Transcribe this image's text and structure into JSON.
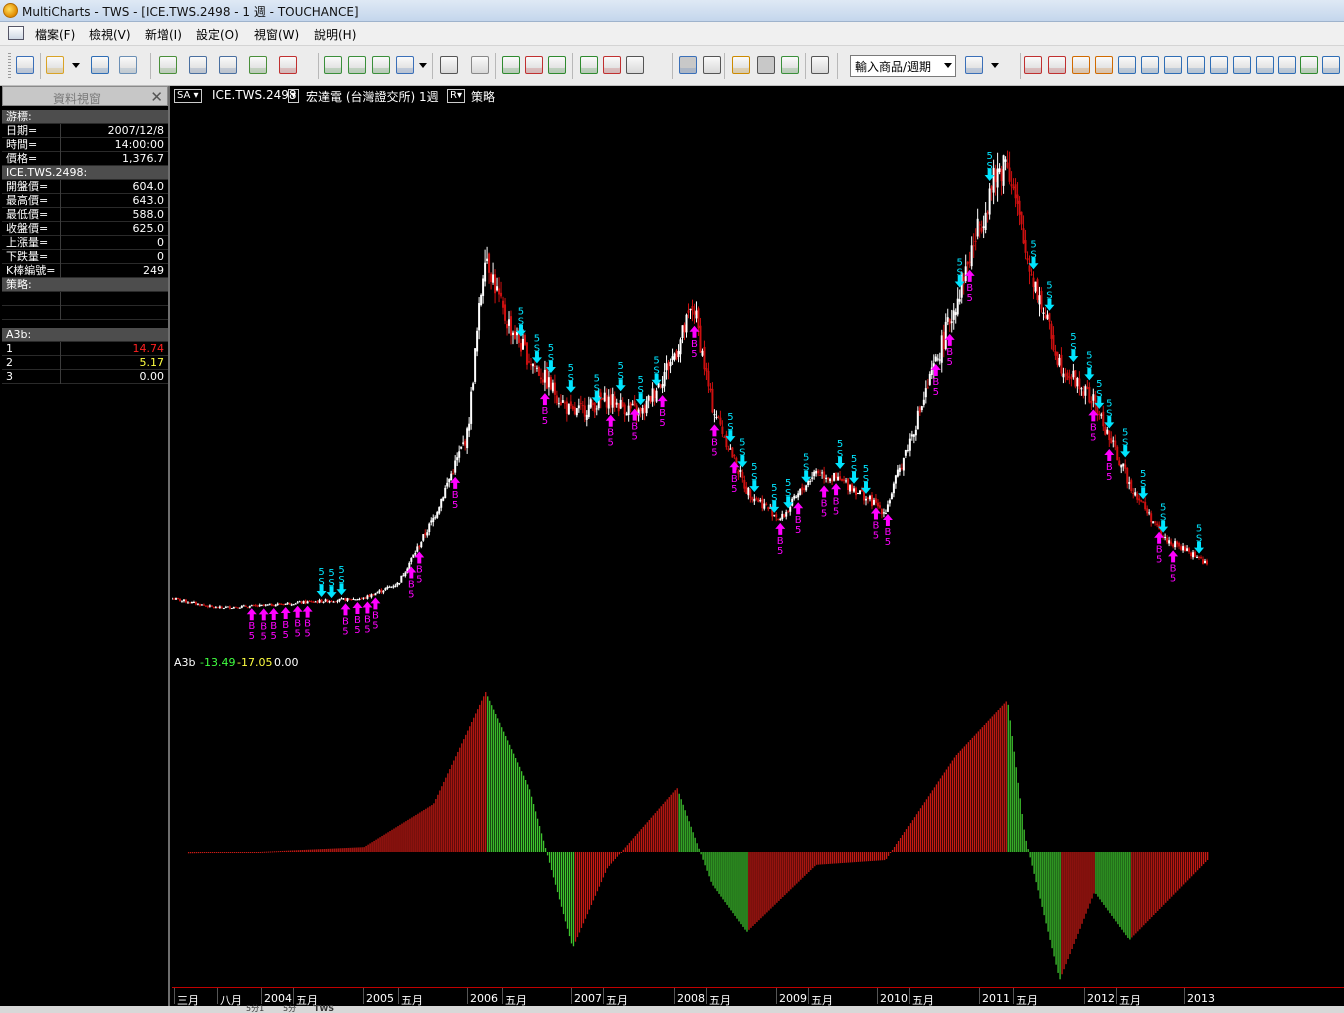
{
  "window": {
    "title": "MultiCharts - TWS - [ICE.TWS.2498 - 1 週 - TOUCHANCE]"
  },
  "menu": [
    "檔案(F)",
    "檢視(V)",
    "新增(I)",
    "設定(O)",
    "視窗(W)",
    "說明(H)"
  ],
  "toolbar": {
    "symbol_combo": "輸入商品/週期",
    "icons": [
      "new-chart-icon",
      "open-icon",
      "save-icon",
      "print-icon",
      "window-icon",
      "window-icon",
      "window-icon",
      "window-icon",
      "window-icon",
      "chart-type-icon",
      "chart-type-icon",
      "chart-type-icon",
      "chart-type-icon",
      "table-icon",
      "table-icon",
      "bars-icon",
      "candles-icon",
      "check-icon",
      "drawing-icon",
      "drawing-icon",
      "drawing-icon",
      "pointer-icon",
      "crosshair-icon",
      "comment-icon",
      "zoom-box-icon",
      "zoom-icon",
      "panel-icon",
      "clock-icon",
      "scroll-left-icon",
      "scroll-right-icon",
      "hourglass-icon",
      "up-down-icon",
      "up-icon",
      "down-icon",
      "left-icon",
      "right-icon",
      "expand-icon",
      "shrink-icon",
      "zoom-in-icon",
      "zoom-out-icon",
      "refresh-icon",
      "autoscale-icon"
    ]
  },
  "data_window": {
    "title": "資料視窗",
    "sections": [
      {
        "heading": "游標:",
        "rows": [
          {
            "label": "日期=",
            "value": "2007/12/8"
          },
          {
            "label": "時間=",
            "value": "14:00:00"
          },
          {
            "label": "價格=",
            "value": "1,376.7"
          }
        ]
      },
      {
        "heading": "ICE.TWS.2498:",
        "rows": [
          {
            "label": "開盤價=",
            "value": "604.0"
          },
          {
            "label": "最高價=",
            "value": "643.0"
          },
          {
            "label": "最低價=",
            "value": "588.0"
          },
          {
            "label": "收盤價=",
            "value": "625.0"
          },
          {
            "label": "上漲量=",
            "value": "0"
          },
          {
            "label": "下跌量=",
            "value": "0"
          },
          {
            "label": "K棒編號=",
            "value": "249"
          }
        ]
      },
      {
        "heading": "策略:",
        "rows": [
          {
            "label": "",
            "value": ""
          },
          {
            "label": "",
            "value": ""
          }
        ]
      },
      {
        "heading": "A3b:",
        "rows": [
          {
            "label": "1",
            "value": "14.74",
            "color": "#ff2020"
          },
          {
            "label": "2",
            "value": "5.17",
            "color": "#ffff40"
          },
          {
            "label": "3",
            "value": "0.00",
            "color": "#ffffff"
          }
        ]
      }
    ]
  },
  "chart": {
    "header": {
      "sa": "SA",
      "symbol": "ICE.TWS.2498",
      "desc": "宏達電 (台灣證交所) 1週",
      "strategy": "策略"
    },
    "indicator": {
      "name": "A3b",
      "v1": "-13.49",
      "v2": "-17.05",
      "v3": "0.00",
      "c1": "#40ff40",
      "c2": "#ffff40",
      "c3": "#ffffff"
    },
    "colors": {
      "up": "#ffffff",
      "down": "#cc1010",
      "buy": "#ff00ff",
      "sell": "#00e5ff",
      "hist_pos": "#c81a14",
      "hist_neg": "#3ec42e"
    },
    "signal_labels": {
      "buy_letter": "B",
      "sell_letter": "S",
      "qty": "5"
    },
    "time_axis": [
      "三月",
      "八月",
      "2004",
      "五月",
      "2005",
      "五月",
      "2006",
      "五月",
      "2007",
      "五月",
      "2008",
      "五月",
      "2009",
      "五月",
      "2010",
      "五月",
      "2011",
      "五月",
      "2012",
      "五月",
      "2013"
    ]
  },
  "tabs": [
    "5分1",
    "5分",
    "TWS"
  ],
  "chart_data": {
    "type": "candlestick",
    "symbol": "ICE.TWS.2498",
    "price_series": {
      "x": [
        "2003-03",
        "2003-08",
        "2004-01",
        "2004-05",
        "2005-01",
        "2005-05",
        "2005-09",
        "2006-01",
        "2006-03",
        "2006-05",
        "2006-08",
        "2007-01",
        "2007-05",
        "2007-09",
        "2008-01",
        "2008-03",
        "2008-05",
        "2008-09",
        "2009-01",
        "2009-05",
        "2009-09",
        "2010-01",
        "2010-05",
        "2010-09",
        "2011-01",
        "2011-03",
        "2011-05",
        "2011-09",
        "2012-01",
        "2012-05",
        "2012-09",
        "2013-01",
        "2013-02"
      ],
      "close": [
        120,
        95,
        100,
        108,
        120,
        160,
        330,
        560,
        1050,
        880,
        760,
        610,
        650,
        610,
        780,
        900,
        640,
        410,
        330,
        460,
        420,
        350,
        620,
        900,
        1200,
        1300,
        1050,
        750,
        640,
        430,
        280,
        230,
        210
      ]
    },
    "indicator_series": {
      "name": "A3b",
      "x": [
        "2003-03",
        "2004-01",
        "2005-01",
        "2005-09",
        "2006-03",
        "2006-08",
        "2007-01",
        "2007-05",
        "2008-01",
        "2008-05",
        "2008-09",
        "2009-05",
        "2010-01",
        "2010-09",
        "2011-03",
        "2011-05",
        "2011-09",
        "2012-01",
        "2012-05",
        "2013-02"
      ],
      "values": [
        -1,
        0,
        3,
        30,
        100,
        40,
        -60,
        -10,
        40,
        -20,
        -50,
        -8,
        -5,
        60,
        95,
        10,
        -80,
        -25,
        -55,
        -5
      ]
    }
  }
}
